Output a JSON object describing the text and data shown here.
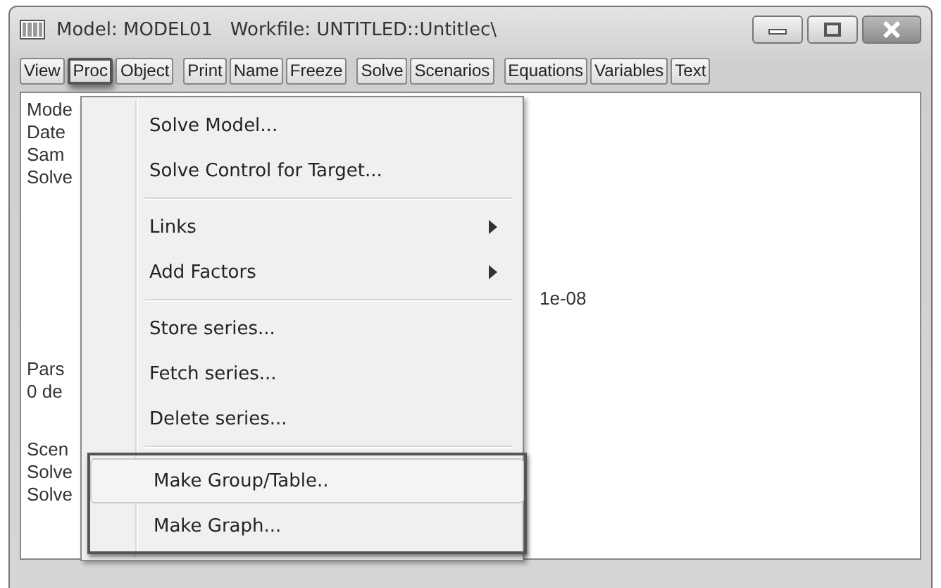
{
  "window": {
    "title": "Model: MODEL01   Workfile: UNTITLED::Untitlec\\"
  },
  "toolbar": [
    [
      {
        "label": "View",
        "selected": false
      },
      {
        "label": "Proc",
        "selected": true
      },
      {
        "label": "Object",
        "selected": false
      }
    ],
    [
      {
        "label": "Print",
        "selected": false
      },
      {
        "label": "Name",
        "selected": false
      },
      {
        "label": "Freeze",
        "selected": false
      }
    ],
    [
      {
        "label": "Solve",
        "selected": false
      },
      {
        "label": "Scenarios",
        "selected": false
      }
    ],
    [
      {
        "label": "Equations",
        "selected": false
      },
      {
        "label": "Variables",
        "selected": false
      },
      {
        "label": "Text",
        "selected": false
      }
    ]
  ],
  "content_lines": [
    "Mode",
    "Date",
    "Sam",
    "Solve",
    "1e-08",
    "Pars",
    "0 de",
    "Scen",
    "Solve",
    "Solve"
  ],
  "menu": {
    "groups": [
      [
        {
          "label": "Solve Model...",
          "submenu": false,
          "selected": false
        },
        {
          "label": "Solve Control for Target...",
          "submenu": false,
          "selected": false
        }
      ],
      [
        {
          "label": "Links",
          "submenu": true,
          "selected": false
        },
        {
          "label": "Add Factors",
          "submenu": true,
          "selected": false
        }
      ],
      [
        {
          "label": "Store series...",
          "submenu": false,
          "selected": false
        },
        {
          "label": "Fetch series...",
          "submenu": false,
          "selected": false
        },
        {
          "label": "Delete series...",
          "submenu": false,
          "selected": false
        }
      ],
      [
        {
          "label": "Make Group/Table..",
          "submenu": false,
          "selected": true
        },
        {
          "label": "Make Graph...",
          "submenu": false,
          "selected": false
        }
      ]
    ]
  }
}
